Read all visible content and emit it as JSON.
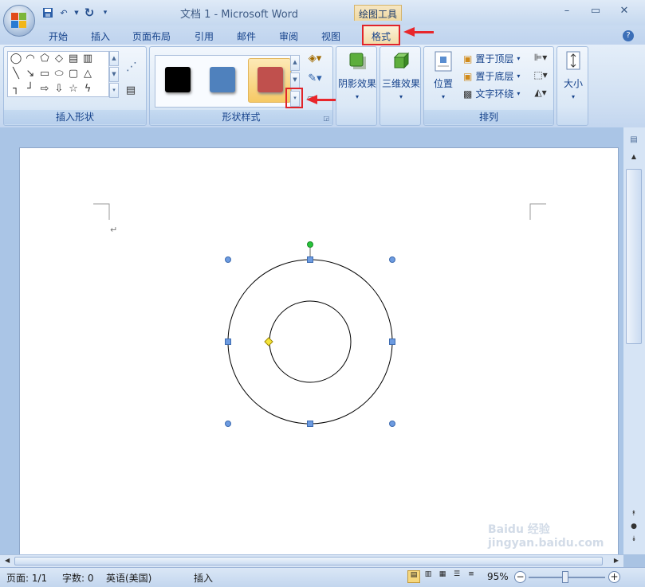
{
  "window": {
    "title": "文档 1 - Microsoft Word",
    "context_tab_group": "绘图工具",
    "controls": [
      "–",
      "▭",
      "✕"
    ]
  },
  "qat": {
    "items": [
      "save-icon",
      "undo-icon",
      "redo-icon",
      "customize-icon"
    ]
  },
  "tabs": [
    {
      "label": "开始"
    },
    {
      "label": "插入"
    },
    {
      "label": "页面布局"
    },
    {
      "label": "引用"
    },
    {
      "label": "邮件"
    },
    {
      "label": "审阅"
    },
    {
      "label": "视图"
    }
  ],
  "active_tab": "格式",
  "groups": {
    "insert_shapes": "插入形状",
    "shape_styles": "形状样式",
    "shadow": "阴影效果",
    "threed": "三维效果",
    "arrange": "排列",
    "position": "位置",
    "bring_front": "置于顶层",
    "send_back": "置于底层",
    "text_wrap": "文字环绕",
    "size": "大小"
  },
  "styles": {
    "swatches": [
      "#000000",
      "#4f81bd",
      "#c0504d"
    ]
  },
  "status": {
    "page": "页面: 1/1",
    "words": "字数: 0",
    "language": "英语(美国)",
    "mode": "插入",
    "zoom": "95%"
  },
  "watermark": "Baidu 经验 jingyan.baidu.com"
}
